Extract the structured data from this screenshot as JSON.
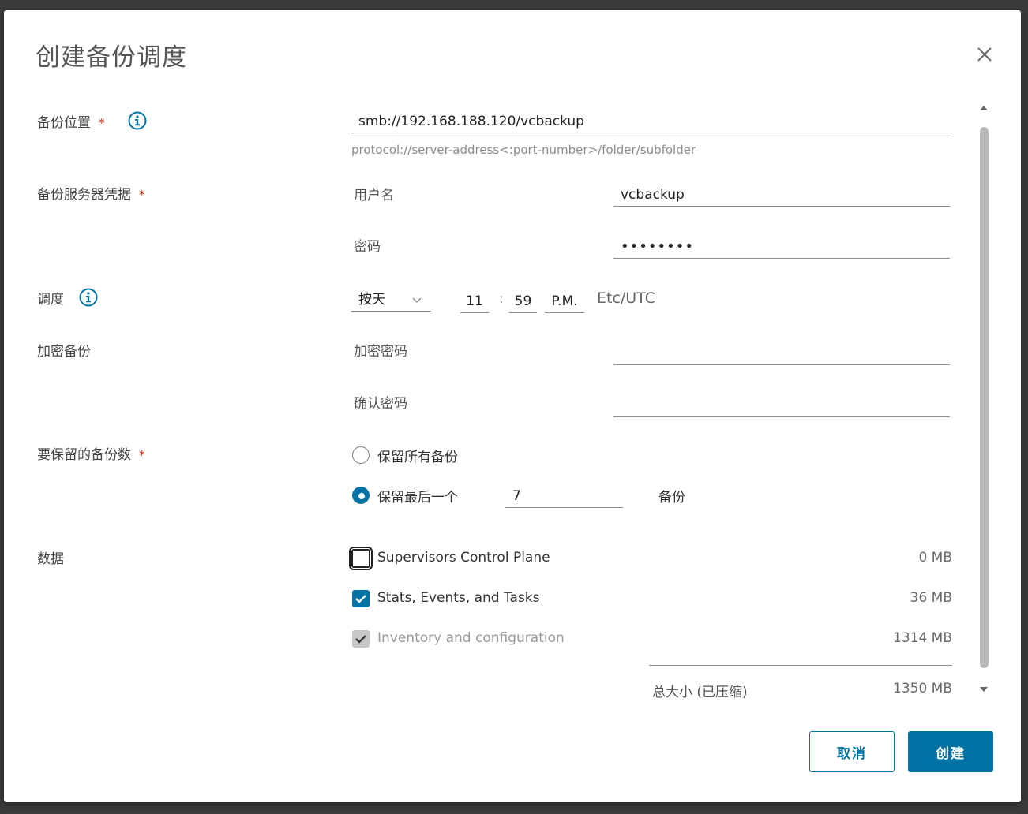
{
  "dialog": {
    "title": "创建备份调度",
    "close_icon": "close-icon"
  },
  "location": {
    "label": "备份位置",
    "required": "*",
    "value": "smb://192.168.188.120/vcbackup",
    "hint": "protocol://server-address<:port-number>/folder/subfolder"
  },
  "credentials": {
    "label": "备份服务器凭据",
    "required": "*",
    "username_label": "用户名",
    "username_value": "vcbackup",
    "password_label": "密码",
    "password_value": "••••••••"
  },
  "schedule": {
    "label": "调度",
    "frequency": "按天",
    "hour": "11",
    "separator": ":",
    "minute": "59",
    "ampm": "P.M.",
    "timezone": "Etc/UTC"
  },
  "encryption": {
    "label": "加密备份",
    "password_label": "加密密码",
    "password_value": "",
    "confirm_label": "确认密码",
    "confirm_value": ""
  },
  "retention": {
    "label": "要保留的备份数",
    "required": "*",
    "keep_all_label": "保留所有备份",
    "keep_last_label": "保留最后一个",
    "keep_last_value": "7",
    "unit": "备份",
    "selected": "keep_last"
  },
  "data": {
    "label": "数据",
    "items": [
      {
        "label": "Supervisors Control Plane",
        "size": "0 MB",
        "checked": false,
        "disabled": false
      },
      {
        "label": "Stats, Events, and Tasks",
        "size": "36 MB",
        "checked": true,
        "disabled": false
      },
      {
        "label": "Inventory and configuration",
        "size": "1314 MB",
        "checked": true,
        "disabled": true
      }
    ],
    "total_label": "总大小 (已压缩)",
    "total_size": "1350 MB"
  },
  "buttons": {
    "cancel": "取消",
    "create": "创建"
  },
  "colors": {
    "accent": "#0072a3",
    "required": "#c92100"
  }
}
